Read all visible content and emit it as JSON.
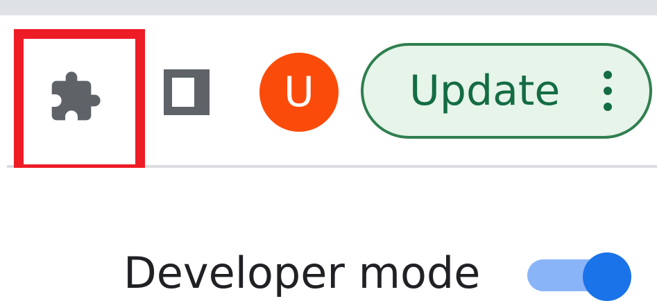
{
  "toolbar": {
    "avatar_initial": "U",
    "update_label": "Update"
  },
  "settings": {
    "developer_mode_label": "Developer mode",
    "developer_mode_on": true
  },
  "colors": {
    "highlight": "#ee1c25",
    "icon_gray": "#5f6368",
    "avatar_bg": "#fb4b0a",
    "update_bg": "#e6f4ea",
    "update_border": "#2f7f4f",
    "update_text": "#146c43",
    "toggle_track": "#8ab4f8",
    "toggle_knob": "#1a73e8"
  },
  "icons": {
    "extensions": "puzzle-piece-icon",
    "side_panel": "side-panel-icon",
    "menu": "more-vert-icon"
  }
}
